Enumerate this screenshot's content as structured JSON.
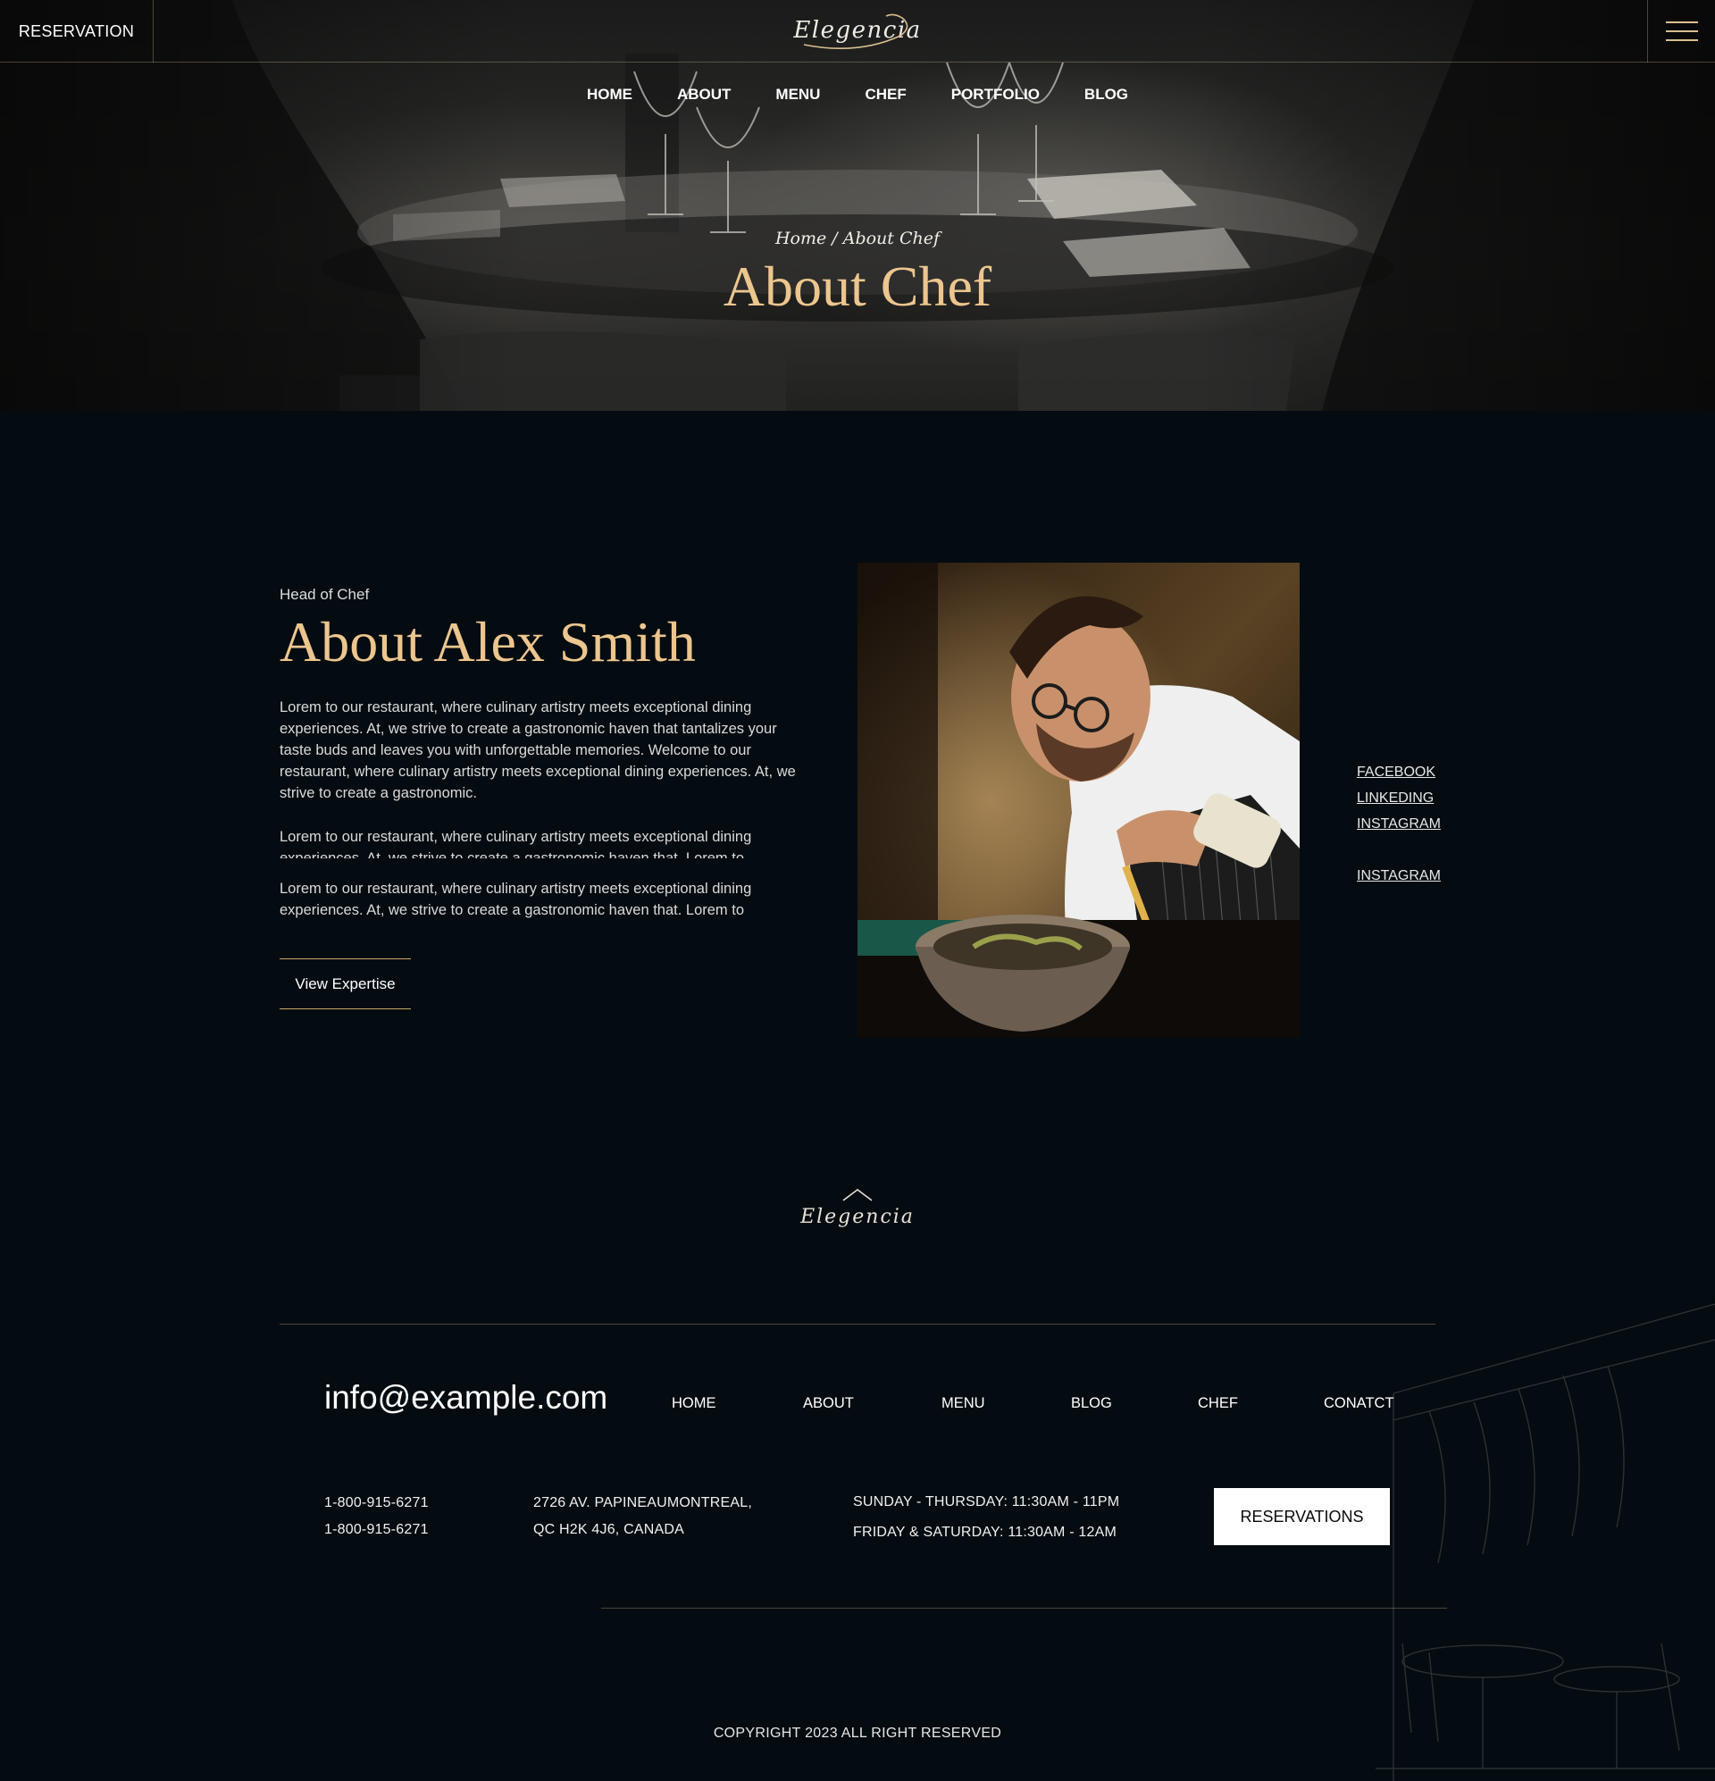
{
  "header": {
    "reservation_label": "RESERVATION",
    "logo_text": "Elegencia",
    "nav": [
      "HOME",
      "ABOUT",
      "MENU",
      "CHEF",
      "PORTFOLIO",
      "BLOG"
    ]
  },
  "hero": {
    "breadcrumb": "Home / About Chef",
    "title": "About Chef"
  },
  "about": {
    "subtitle": "Head of Chef",
    "title": "About Alex Smith",
    "paragraphs": [
      "Lorem to our restaurant, where culinary artistry meets exceptional dining experiences. At, we strive to create a gastronomic haven that tantalizes your taste buds and leaves you with unforgettable memories. Welcome to our restaurant, where culinary artistry meets exceptional dining experiences. At, we strive to create a gastronomic.",
      "Lorem to our restaurant, where culinary artistry meets exceptional dining experiences. At, we strive to create a gastronomic haven that. Lorem to",
      "Lorem to our restaurant, where culinary artistry meets exceptional dining experiences. At, we strive to create a gastronomic haven that. Lorem to"
    ],
    "button_label": "View Expertise",
    "social": [
      "FACEBOOK",
      "LINKEDING",
      "INSTAGRAM",
      "INSTAGRAM"
    ]
  },
  "footer": {
    "logo_text": "Elegencia",
    "email": "info@example.com",
    "nav": [
      "HOME",
      "ABOUT",
      "MENU",
      "BLOG",
      "CHEF",
      "CONATCT"
    ],
    "phones": [
      "1-800-915-6271",
      "1-800-915-6271"
    ],
    "address": [
      "2726 AV. PAPINEAUMONTREAL,",
      "QC H2K 4J6, CANADA"
    ],
    "hours": [
      "SUNDAY - THURSDAY: 11:30AM - 11PM",
      "FRIDAY & SATURDAY: 11:30AM - 12AM"
    ],
    "reservations_button": "RESERVATIONS",
    "copyright": "COPYRIGHT 2023 ALL RIGHT RESERVED"
  },
  "colors": {
    "accent_gold": "#ecc68e",
    "background": "#050c11"
  }
}
